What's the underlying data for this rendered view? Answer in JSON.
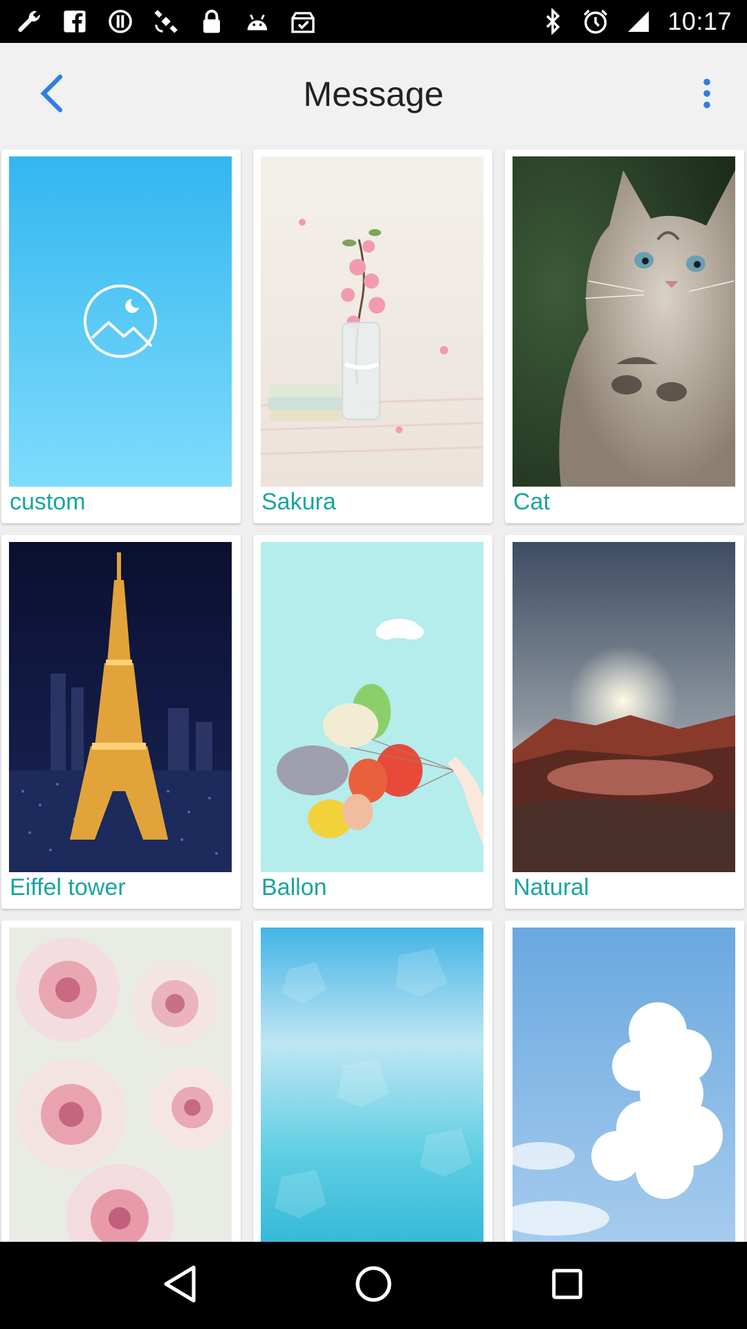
{
  "status_bar": {
    "time": "10:17",
    "left_icons": [
      "wrench-icon",
      "facebook-icon",
      "sync-icon",
      "satellite-icon",
      "lock-icon",
      "android-icon",
      "clipboard-check-icon"
    ],
    "right_icons": [
      "bluetooth-icon",
      "alarm-icon",
      "signal-icon"
    ]
  },
  "header": {
    "title": "Message",
    "back_icon": "chevron-left-icon",
    "menu_icon": "more-vertical-icon",
    "accent_color": "#2f7fe0"
  },
  "wallpapers": [
    {
      "label": "custom"
    },
    {
      "label": "Sakura"
    },
    {
      "label": "Cat"
    },
    {
      "label": "Eiffel tower"
    },
    {
      "label": "Ballon"
    },
    {
      "label": "Natural"
    },
    {
      "label": ""
    },
    {
      "label": ""
    },
    {
      "label": ""
    }
  ],
  "label_color": "#16a5a0",
  "nav": {
    "back_icon": "triangle-back-icon",
    "home_icon": "circle-home-icon",
    "recents_icon": "square-recents-icon"
  }
}
